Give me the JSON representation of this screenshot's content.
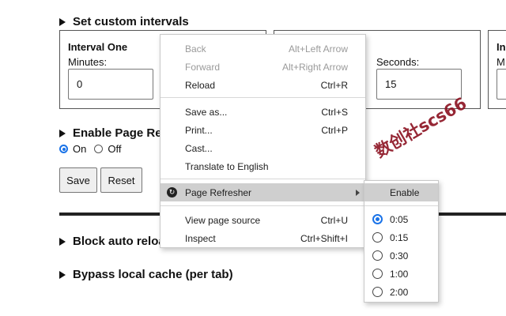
{
  "sections": {
    "custom_intervals": "Set custom intervals",
    "enable_page_refresh": "Enable Page Ref",
    "block_auto_reload": "Block auto reloa",
    "bypass_cache": "Bypass local cache (per tab)"
  },
  "interval_one": {
    "title": "Interval One",
    "minutes_label": "Minutes:",
    "minutes_value": "0"
  },
  "interval_two": {
    "seconds_label": "Seconds:",
    "seconds_value": "15"
  },
  "interval_three": {
    "title": "In",
    "label": "M"
  },
  "enable_radio": {
    "on_label": "On",
    "off_label": "Off",
    "selected": "On"
  },
  "buttons": {
    "save": "Save",
    "reset": "Reset"
  },
  "context_menu": {
    "items": [
      {
        "label": "Back",
        "shortcut": "Alt+Left Arrow",
        "disabled": true
      },
      {
        "label": "Forward",
        "shortcut": "Alt+Right Arrow",
        "disabled": true
      },
      {
        "label": "Reload",
        "shortcut": "Ctrl+R",
        "disabled": false
      },
      {
        "label": "Save as...",
        "shortcut": "Ctrl+S",
        "disabled": false
      },
      {
        "label": "Print...",
        "shortcut": "Ctrl+P",
        "disabled": false
      },
      {
        "label": "Cast...",
        "shortcut": "",
        "disabled": false
      },
      {
        "label": "Translate to English",
        "shortcut": "",
        "disabled": false
      },
      {
        "label": "Page Refresher",
        "shortcut": "",
        "disabled": false,
        "icon": "refresh-icon",
        "highlighted": true
      },
      {
        "label": "View page source",
        "shortcut": "Ctrl+U",
        "disabled": false
      },
      {
        "label": "Inspect",
        "shortcut": "Ctrl+Shift+I",
        "disabled": false
      }
    ]
  },
  "submenu": {
    "enable_label": "Enable",
    "options": [
      "0:05",
      "0:15",
      "0:30",
      "1:00",
      "2:00"
    ],
    "selected": "0:05"
  },
  "watermark": "数创社scs66",
  "colors": {
    "accent": "#1a73e8",
    "highlight": "#cfcfcf",
    "watermark": "#8b1020"
  }
}
